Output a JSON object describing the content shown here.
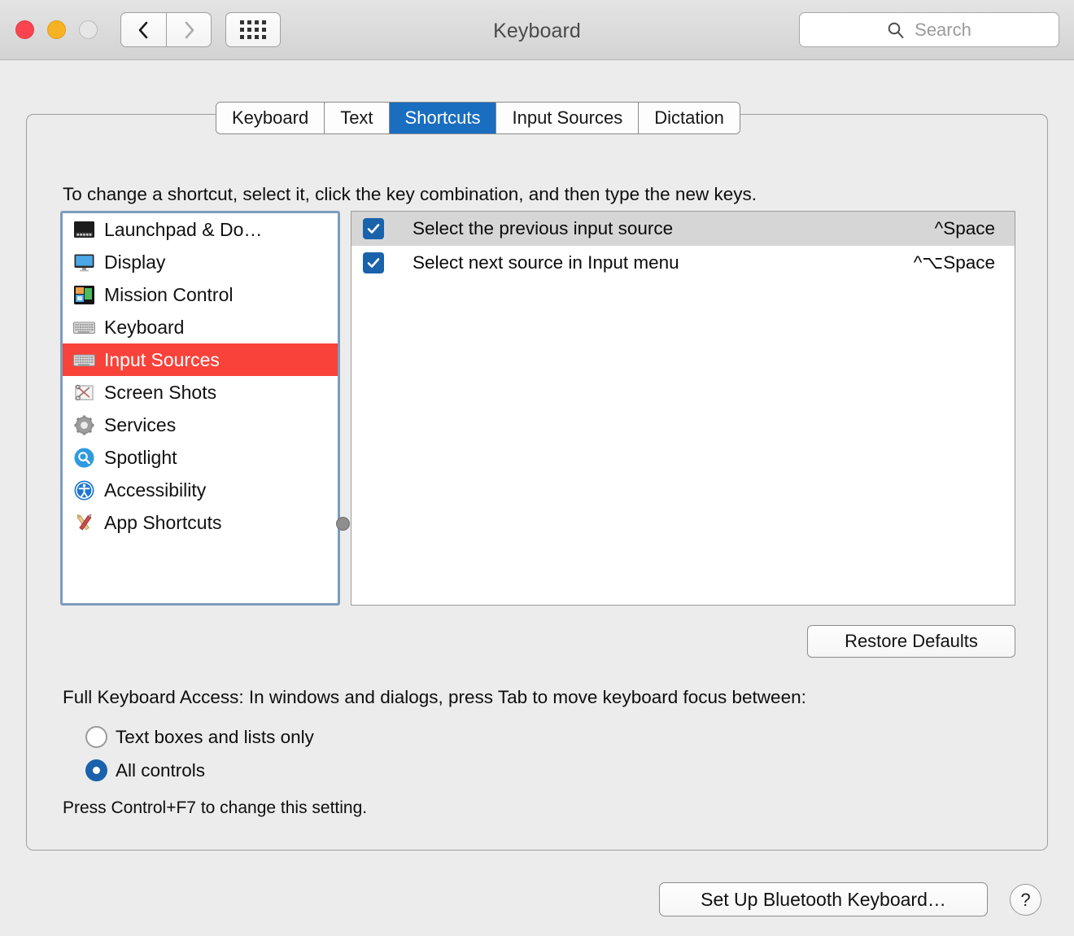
{
  "window": {
    "title": "Keyboard",
    "traffic_lights": [
      "close",
      "minimize",
      "zoom"
    ],
    "nav_back": "back-chevron",
    "nav_forward": "forward-chevron",
    "show_all": "grid-icon",
    "search": {
      "placeholder": "Search",
      "value": "",
      "icon": "search-icon"
    }
  },
  "tabs": [
    {
      "label": "Keyboard",
      "active": false
    },
    {
      "label": "Text",
      "active": false
    },
    {
      "label": "Shortcuts",
      "active": true
    },
    {
      "label": "Input Sources",
      "active": false
    },
    {
      "label": "Dictation",
      "active": false
    }
  ],
  "instruction": "To change a shortcut, select it, click the key combination, and then type the new keys.",
  "sidebar": {
    "items": [
      {
        "label": "Launchpad & Do…",
        "icon": "launchpad-dock-icon",
        "selected": false
      },
      {
        "label": "Display",
        "icon": "display-icon",
        "selected": false
      },
      {
        "label": "Mission Control",
        "icon": "mission-control-icon",
        "selected": false
      },
      {
        "label": "Keyboard",
        "icon": "keyboard-icon",
        "selected": false
      },
      {
        "label": "Input Sources",
        "icon": "input-sources-icon",
        "selected": true
      },
      {
        "label": "Screen Shots",
        "icon": "screen-shots-icon",
        "selected": false
      },
      {
        "label": "Services",
        "icon": "services-gear-icon",
        "selected": false
      },
      {
        "label": "Spotlight",
        "icon": "spotlight-icon",
        "selected": false
      },
      {
        "label": "Accessibility",
        "icon": "accessibility-icon",
        "selected": false
      },
      {
        "label": "App Shortcuts",
        "icon": "app-shortcuts-icon",
        "selected": false
      }
    ],
    "selection_color": "#f8423a",
    "splitter": "splitter-handle"
  },
  "shortcuts": {
    "rows": [
      {
        "checked": true,
        "name": "Select the previous input source",
        "key": "^Space",
        "selected": true
      },
      {
        "checked": true,
        "name": "Select next source in Input menu",
        "key": "^⌥Space",
        "selected": false
      }
    ],
    "checkbox_color": "#1a62ab",
    "row_selection_color": "#d6d6d6"
  },
  "restore_defaults_label": "Restore Defaults",
  "full_keyboard_access": {
    "label": "Full Keyboard Access: In windows and dialogs, press Tab to move keyboard focus between:",
    "options": [
      {
        "label": "Text boxes and lists only",
        "selected": false
      },
      {
        "label": "All controls",
        "selected": true
      }
    ],
    "hint": "Press Control+F7 to change this setting."
  },
  "footer": {
    "bluetooth_label": "Set Up Bluetooth Keyboard…",
    "help_label": "?"
  }
}
